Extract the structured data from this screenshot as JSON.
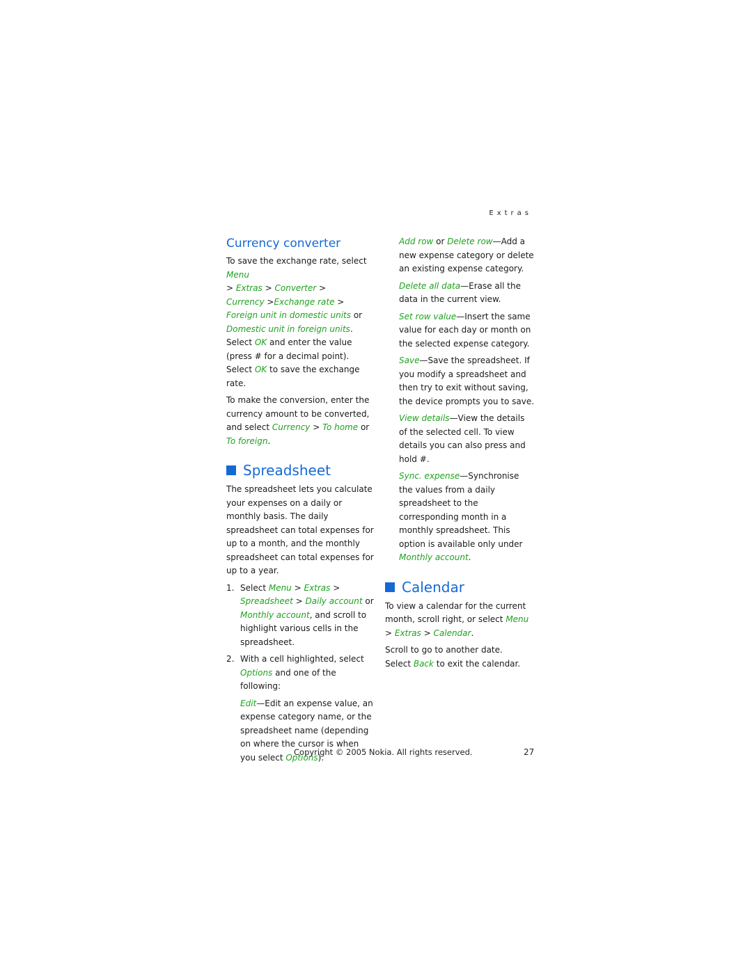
{
  "running_head": "Extras",
  "currency": {
    "title": "Currency converter",
    "p1": {
      "t1": "To save the exchange rate, select ",
      "menu": "Menu",
      "t2": " > ",
      "extras": "Extras",
      "t3": " > ",
      "converter": "Converter",
      "t4": " > ",
      "currency": "Currency",
      "t5": " >",
      "exchange_rate": "Exchange rate",
      "t6": " > ",
      "foreign_in_domestic": "Foreign unit in domestic units",
      "t7": " or ",
      "domestic_in_foreign": "Domestic unit in foreign units",
      "t8": ". Select ",
      "ok1": "OK",
      "t9": " and enter the value (press # for a decimal point). Select ",
      "ok2": "OK",
      "t10": " to save the exchange rate."
    },
    "p2": {
      "t1": "To make the conversion, enter the currency amount to be converted, and select ",
      "currency": "Currency",
      "t2": " > ",
      "to_home": "To home",
      "t3": " or ",
      "to_foreign": "To foreign",
      "t4": "."
    }
  },
  "spreadsheet": {
    "title": "Spreadsheet",
    "intro": "The spreadsheet lets you calculate your expenses on a daily or monthly basis. The daily spreadsheet can total expenses for up to a month, and the monthly spreadsheet can total expenses for up to a year.",
    "step1": {
      "num": "1.",
      "t1": "Select ",
      "menu": "Menu",
      "t2": " > ",
      "extras": "Extras",
      "t3": " > ",
      "spreadsheet": "Spreadsheet",
      "t4": " > ",
      "daily": "Daily account",
      "t5": " or ",
      "monthly": "Monthly account",
      "t6": ", and scroll to highlight various cells in the spreadsheet."
    },
    "step2": {
      "num": "2.",
      "t1": "With a cell highlighted, select ",
      "options": "Options",
      "t2": " and one of the following:"
    },
    "options": [
      {
        "term": "Edit",
        "desc": "—Edit an expense value, an expense category name, or the spreadsheet name (depending on where the cursor is when you select ",
        "term2": "Options",
        "tail": ")."
      },
      {
        "term": "Add row",
        "mid": " or ",
        "term_b": "Delete row",
        "desc": "—Add a new expense category or delete an existing expense category."
      },
      {
        "term": "Delete all data",
        "desc": "—Erase all the data in the current view."
      },
      {
        "term": "Set row value",
        "desc": "—Insert the same value for each day or month on the selected expense category."
      },
      {
        "term": "Save",
        "desc": "—Save the spreadsheet. If you modify a spreadsheet and then try to exit without saving, the device prompts you to save."
      },
      {
        "term": "View details",
        "desc": "—View the details of the selected cell. To view details you can also press and hold #."
      },
      {
        "term": "Sync. expense",
        "desc": "—Synchronise the values from a daily spreadsheet to the corresponding month in a monthly spreadsheet. This option is available only under ",
        "term2": "Monthly account",
        "tail": "."
      }
    ]
  },
  "calendar": {
    "title": "Calendar",
    "p1": {
      "t1": "To view a calendar for the current month, scroll right, or select ",
      "menu": "Menu",
      "t2": " > ",
      "extras": "Extras",
      "t3": " > ",
      "calendar": "Calendar",
      "t4": "."
    },
    "p2": {
      "line1": "Scroll to go to another date.",
      "t1": "Select ",
      "back": "Back",
      "t2": " to exit the calendar."
    }
  },
  "footer": {
    "copyright": "Copyright © 2005 Nokia. All rights reserved.",
    "page_number": "27"
  },
  "colors": {
    "heading_blue": "#1569d6",
    "menu_green": "#1fa21f"
  }
}
